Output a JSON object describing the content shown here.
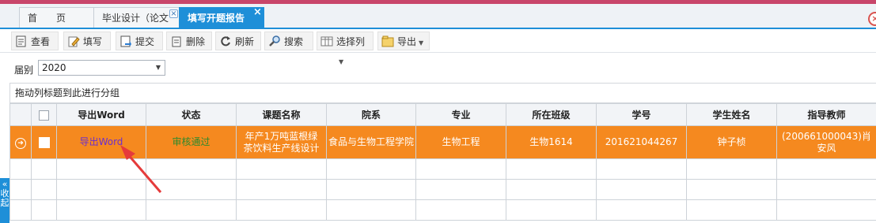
{
  "tabs": [
    {
      "label": "首　　页"
    },
    {
      "label": "毕业设计（论文",
      "close": "×"
    },
    {
      "label": "填写开题报告",
      "close": "×"
    }
  ],
  "window_close": "×",
  "toolbar": {
    "view": "查看",
    "fill": "填写",
    "submit": "提交",
    "delete": "删除",
    "refresh": "刷新",
    "search": "搜索",
    "select_columns": "选择列",
    "export": "导出"
  },
  "filter": {
    "label": "届别",
    "value": "2020"
  },
  "group_panel": "拖动列标题到此进行分组",
  "side_tab": "«\n收\n起",
  "table": {
    "headers": [
      "导出Word",
      "状态",
      "课题名称",
      "院系",
      "专业",
      "所在班级",
      "学号",
      "学生姓名",
      "指导教师"
    ],
    "row": {
      "export": "导出Word",
      "status": "审核通过",
      "title": "年产1万吨蓝根绿茶饮料生产线设计",
      "dept": "食品与生物工程学院",
      "major": "生物工程",
      "class": "生物1614",
      "student_id": "201621044267",
      "name": "钟子桢",
      "advisor": "(200661000043)肖安风"
    }
  },
  "colors": {
    "accent": "#1e8fd8",
    "selected_row": "#f5891f",
    "annotation": "#e53b3b"
  }
}
